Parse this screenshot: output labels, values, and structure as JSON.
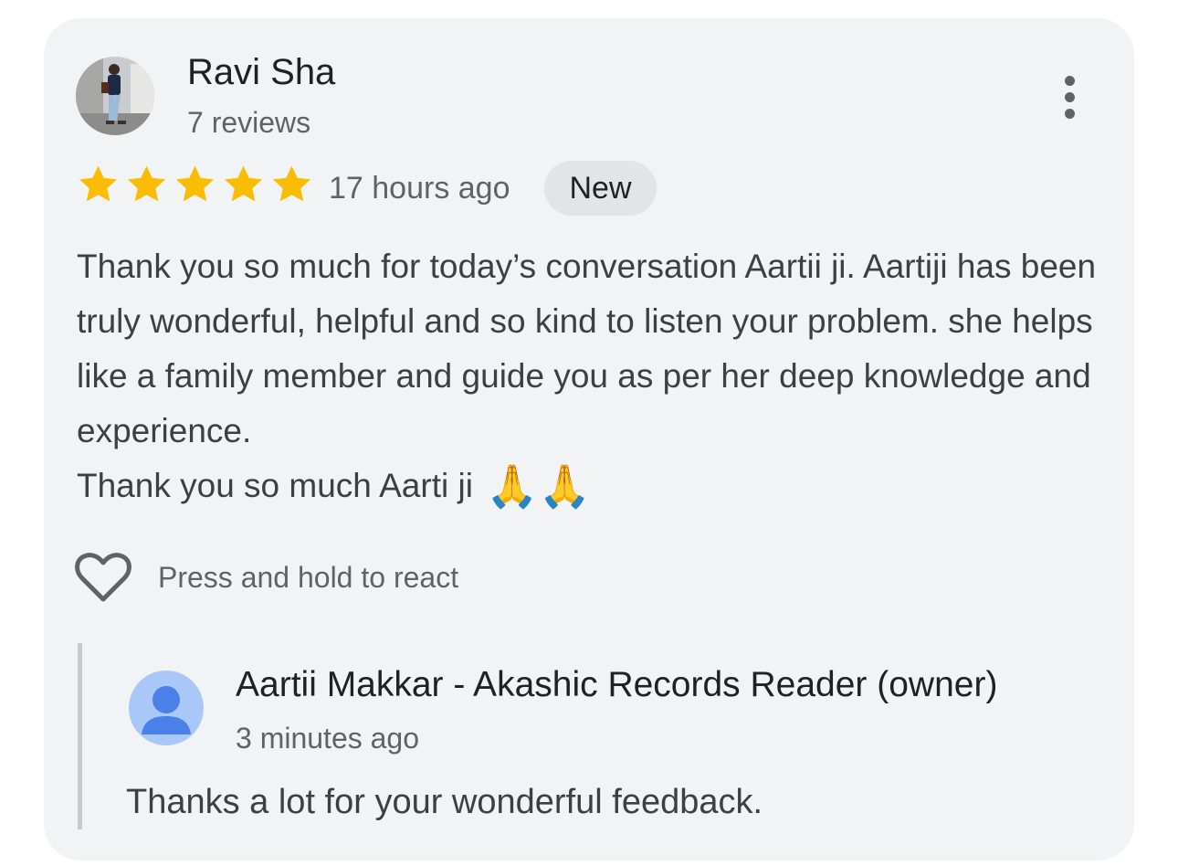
{
  "review": {
    "reviewer_name": "Ravi Sha",
    "review_count": "7 reviews",
    "rating": 5,
    "rating_max": 5,
    "time_ago": "17 hours ago",
    "badge": "New",
    "text_line1": "Thank you so much for today’s conversation Aartii ji. Aartiji has been truly wonderful, helpful and so kind to listen your problem. she helps like a family member and guide you as per her deep knowledge and experience.",
    "text_line2": "Thank you so much Aarti ji",
    "emoji": "🙏🙏",
    "react_label": "Press and hold to react",
    "menu_icon": "more-vert-icon",
    "react_icon": "heart-outline-icon"
  },
  "owner_reply": {
    "name": "Aartii Makkar - Akashic Records Reader (owner)",
    "time_ago": "3 minutes ago",
    "text": "Thanks a lot for your wonderful feedback.",
    "avatar_icon": "person-icon"
  },
  "colors": {
    "card_bg": "#f2f3f5",
    "star": "#fbbc04",
    "badge_bg": "#e3e4e7",
    "owner_avatar_bg": "#a9c7f7",
    "owner_avatar_fg": "#4a80e8"
  }
}
